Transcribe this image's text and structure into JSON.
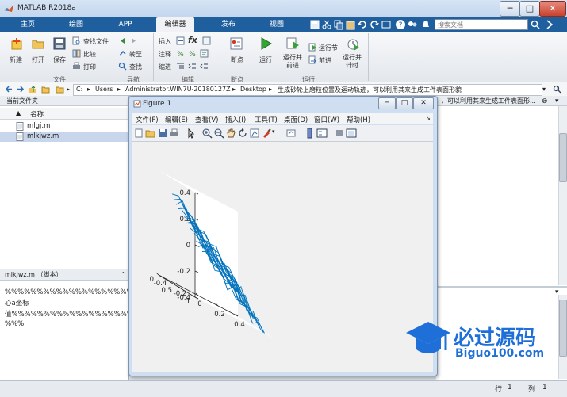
{
  "window": {
    "title": "MATLAB R2018a",
    "minimize": "─",
    "maximize": "□",
    "close": "✕"
  },
  "tabs": [
    {
      "label": "主页"
    },
    {
      "label": "绘图"
    },
    {
      "label": "APP"
    },
    {
      "label": "编辑器",
      "active": true
    },
    {
      "label": "发布"
    },
    {
      "label": "视图"
    }
  ],
  "search": {
    "placeholder": "搜索文档"
  },
  "ribbon": {
    "groups": {
      "file": "文件",
      "navigate": "导航",
      "edit": "编辑",
      "breakpoints": "断点",
      "run": "运行"
    },
    "file": {
      "new": "新建",
      "open": "打开",
      "save": "保存",
      "find_files": "查找文件",
      "compare": "比较",
      "print": "打印"
    },
    "navigate": {
      "goto": "转至",
      "find": "查找"
    },
    "edit": {
      "insert": "插入",
      "fx": "fx",
      "comment": "注释",
      "indent": "缩进"
    },
    "breakpoints": {
      "breakpoints": "断点"
    },
    "run": {
      "run": "运行",
      "run_advance": "运行并\n前进",
      "run_section": "运行节",
      "advance": "前进",
      "run_time": "运行并\n计时"
    }
  },
  "address": {
    "crumbs": [
      "C:",
      "Users",
      "Administrator.WIN7U-20180127Z",
      "Desktop",
      "生成砂轮上磨粒位置及运动轨迹，可以利用其来生成工件表面形貌"
    ]
  },
  "current_folder": {
    "title": "当前文件夹",
    "col_name": "名称",
    "sort": "▲",
    "files": [
      {
        "name": "mlgj.m",
        "selected": false
      },
      {
        "name": "mlkjwz.m",
        "selected": true
      }
    ]
  },
  "details": {
    "title": "mlkjwz.m （脚本）",
    "lines": [
      "%%%%%%%%%%%%%%%%%%%%磨粒中",
      "心a坐标",
      "值%%%%%%%%%%%%%%%%%%%%%",
      "%%%"
    ]
  },
  "editor_right": {
    "header_text": "，可以利用其来生成工件表面形..."
  },
  "figure": {
    "title": "Figure 1",
    "menus": [
      "文件(F)",
      "编辑(E)",
      "查看(V)",
      "插入(I)",
      "工具(T)",
      "桌面(D)",
      "窗口(W)",
      "帮助(H)"
    ],
    "min": "─",
    "max": "□",
    "close": "✕"
  },
  "chart_data": {
    "type": "line",
    "series_style": "3-D line plot (zigzag grinding-grain trajectories)",
    "color": "#0072BD",
    "z_ticks": [
      "0.4",
      "0.2",
      "0",
      "-0.2",
      "-0.4"
    ],
    "y_ticks": [
      "1",
      "0.5",
      "0"
    ],
    "x_ticks": [
      "-0.4",
      "-0.2",
      "0",
      "0.2",
      "0.4"
    ],
    "zlim": [
      -0.4,
      0.4
    ],
    "ylim": [
      0,
      1
    ],
    "xlim": [
      -0.4,
      0.4
    ],
    "grid": false
  },
  "status": {
    "row_label": "行",
    "row": "1",
    "col_label": "列",
    "col": "1"
  },
  "watermark": {
    "cn": "必过源码",
    "en": "Biguo100.com"
  }
}
